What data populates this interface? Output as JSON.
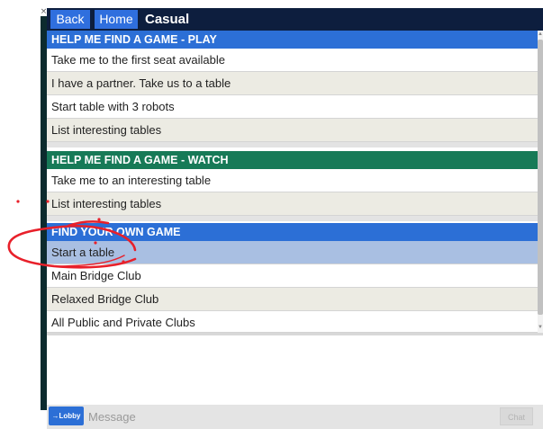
{
  "window": {
    "close_glyph": "×"
  },
  "topbar": {
    "back_label": "Back",
    "home_label": "Home",
    "title": "Casual"
  },
  "sections": {
    "play": {
      "header": "HELP ME FIND A GAME - PLAY",
      "header_color": "#2c6fd6",
      "items": [
        "Take me to the first seat available",
        "I have a partner. Take us to a table",
        "Start table with 3 robots",
        "List interesting tables"
      ]
    },
    "watch": {
      "header": "HELP ME FIND A GAME - WATCH",
      "header_color": "#177a57",
      "items": [
        "Take me to an interesting table",
        "List interesting tables"
      ]
    },
    "own": {
      "header": "FIND YOUR OWN GAME",
      "header_color": "#2c6fd6",
      "items": [
        "Start a table",
        "Main Bridge Club",
        "Relaxed Bridge Club",
        "All Public and Private Clubs"
      ],
      "selected_item": "Start a table"
    }
  },
  "chat": {
    "lobby_label": "→Lobby",
    "placeholder": "Message",
    "send_label": "Chat"
  },
  "annotation": {
    "color": "#e8202a",
    "description_shape": "circle-scribble"
  },
  "icons": {
    "close": "close-icon",
    "scroll_up": "scroll-up-icon",
    "scroll_down": "scroll-down-icon"
  }
}
